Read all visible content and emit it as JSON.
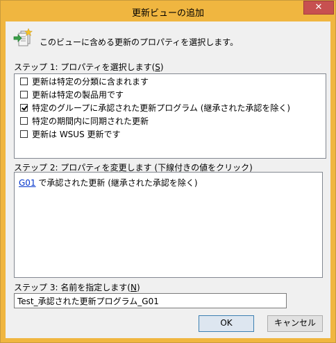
{
  "window": {
    "title": "更新ビューの追加",
    "close_glyph": "✕"
  },
  "header": {
    "icon": "add-view-icon",
    "text": "このビューに含める更新のプロパティを選択します。"
  },
  "step1": {
    "label_prefix": "ステップ 1: プロパティを選択します(",
    "mnemonic": "S",
    "label_suffix": ")",
    "items": [
      {
        "label": "更新は特定の分類に含まれます",
        "checked": false
      },
      {
        "label": "更新は特定の製品用です",
        "checked": false
      },
      {
        "label": "特定のグループに承認された更新プログラム (継承された承認を除く)",
        "checked": true
      },
      {
        "label": "特定の期間内に同期された更新",
        "checked": false
      },
      {
        "label": "更新は WSUS 更新です",
        "checked": false
      }
    ]
  },
  "step2": {
    "label": "ステップ 2: プロパティを変更します (下線付きの値をクリック)",
    "link_text": "G01",
    "text_after": " で承認された更新 (継承された承認を除く)"
  },
  "step3": {
    "label_prefix": "ステップ 3: 名前を指定します(",
    "mnemonic": "N",
    "label_suffix": ")",
    "name_value": "Test_承認された更新プログラム_G01"
  },
  "buttons": {
    "ok": "OK",
    "cancel": "キャンセル"
  }
}
